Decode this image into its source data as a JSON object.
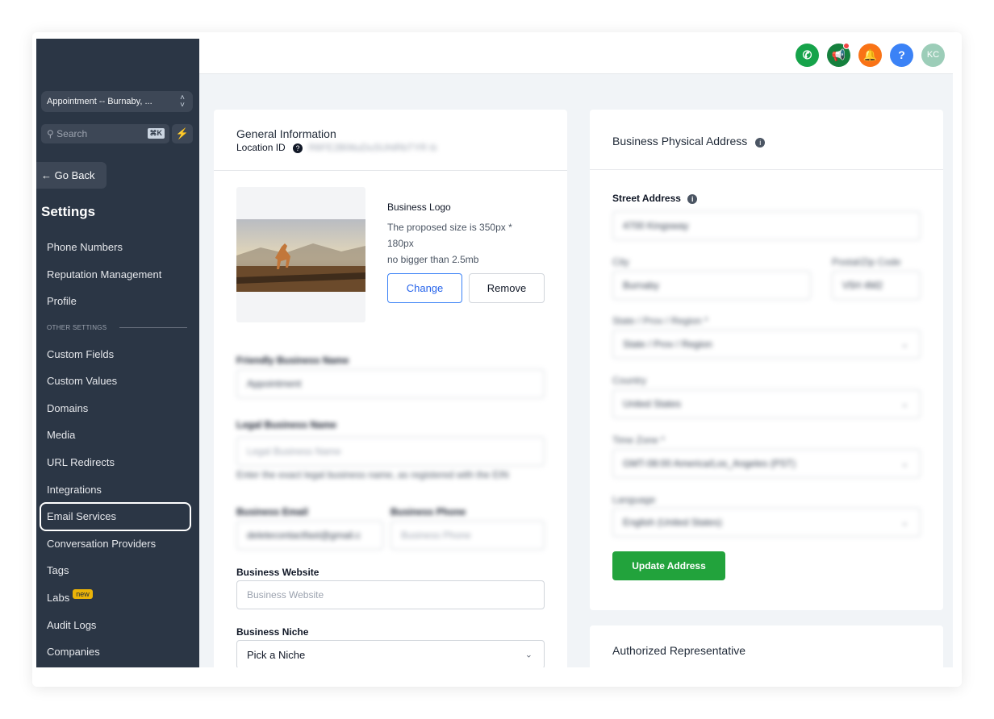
{
  "sidebar": {
    "location_switch": "Appointment -- Burnaby, ...",
    "search_placeholder": "Search",
    "search_shortcut": "⌘K",
    "go_back": "← Go Back",
    "title": "Settings",
    "items": [
      {
        "label": "Phone Numbers"
      },
      {
        "label": "Reputation Management"
      },
      {
        "label": "Profile"
      },
      {
        "label": "Custom Fields"
      },
      {
        "label": "Custom Values"
      },
      {
        "label": "Domains"
      },
      {
        "label": "Media"
      },
      {
        "label": "URL Redirects"
      },
      {
        "label": "Integrations"
      },
      {
        "label": "Email Services"
      },
      {
        "label": "Conversation Providers"
      },
      {
        "label": "Tags"
      },
      {
        "label": "Labs"
      },
      {
        "label": "Audit Logs"
      },
      {
        "label": "Companies"
      }
    ],
    "section_label": "OTHER SETTINGS",
    "labs_badge": "new",
    "highlighted_item": "Email Services"
  },
  "topbar": {
    "avatar_initials": "KC",
    "icons": [
      "phone-icon",
      "megaphone-icon",
      "bell-icon",
      "help-icon",
      "avatar"
    ],
    "colors": {
      "phone": "#16a34a",
      "megaphone": "#15803d",
      "bell": "#f97316",
      "help": "#3b82f6",
      "avatar": "#9ccdb8"
    }
  },
  "general": {
    "title": "General Information",
    "location_id_label": "Location ID",
    "location_id_value": "R6FE2B0ttuDuSUhtRbTYR",
    "logo": {
      "title": "Business Logo",
      "hint_line1": "The proposed size is 350px *",
      "hint_line2": "180px",
      "hint_line3": "no bigger than 2.5mb",
      "change": "Change",
      "remove": "Remove"
    },
    "friendly_name_label": "Friendly Business Name",
    "friendly_name_value": "Appointment",
    "legal_name_label": "Legal Business Name",
    "legal_name_placeholder": "Legal Business Name",
    "legal_name_hint": "Enter the exact legal business name, as registered with the EIN",
    "email_label": "Business Email",
    "email_value": "deletecontactfast@gmail.c",
    "phone_label": "Business Phone",
    "phone_placeholder": "Business Phone",
    "website_label": "Business Website",
    "website_placeholder": "Business Website",
    "niche_label": "Business Niche",
    "niche_value": "Pick a Niche"
  },
  "address": {
    "title": "Business Physical Address",
    "street_label": "Street Address",
    "street_value": "4700 Kingsway",
    "city_label": "City",
    "city_value": "Burnaby",
    "zip_label": "Postal/Zip Code",
    "zip_value": "V5H 4M2",
    "state_label": "State / Prov / Region *",
    "state_value": "State / Prov / Region",
    "country_label": "Country",
    "country_value": "United States",
    "tz_label": "Time Zone *",
    "tz_value": "GMT-08:00 America/Los_Angeles (PST)",
    "language_label": "Language",
    "language_value": "English (United States)",
    "update_button": "Update Address",
    "accent": "#22a33c"
  },
  "representative": {
    "title": "Authorized Representative"
  }
}
